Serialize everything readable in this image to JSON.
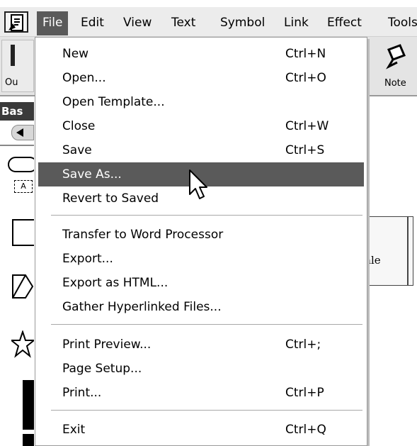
{
  "menubar": {
    "items": [
      "File",
      "Edit",
      "View",
      "Text",
      "Symbol",
      "Link",
      "Effect",
      "Tools"
    ],
    "active": "File"
  },
  "toolbar": {
    "left_label": "Ou",
    "note_label": "Note"
  },
  "palette": {
    "header": "Bas",
    "text_tool_label": "A"
  },
  "background": {
    "card_text": "ale"
  },
  "file_menu": {
    "items": [
      {
        "label": "New",
        "shortcut": "Ctrl+N"
      },
      {
        "label": "Open...",
        "shortcut": "Ctrl+O"
      },
      {
        "label": "Open Template...",
        "shortcut": ""
      },
      {
        "label": "Close",
        "shortcut": "Ctrl+W"
      },
      {
        "label": "Save",
        "shortcut": "Ctrl+S"
      },
      {
        "label": "Save As...",
        "shortcut": "",
        "highlighted": true
      },
      {
        "label": "Revert to Saved",
        "shortcut": ""
      },
      {
        "label": "Transfer to Word Processor",
        "shortcut": ""
      },
      {
        "label": "Export...",
        "shortcut": ""
      },
      {
        "label": "Export as HTML...",
        "shortcut": ""
      },
      {
        "label": "Gather Hyperlinked Files...",
        "shortcut": ""
      },
      {
        "label": "Print Preview...",
        "shortcut": "Ctrl+;"
      },
      {
        "label": "Page Setup...",
        "shortcut": ""
      },
      {
        "label": "Print...",
        "shortcut": "Ctrl+P"
      },
      {
        "label": "Exit",
        "shortcut": "Ctrl+Q"
      }
    ]
  },
  "colors": {
    "highlight": "#5a5a5a",
    "menubar_bg": "#ececec"
  },
  "icons": {
    "app": "app-document-icon",
    "note": "note-pen-icon",
    "cursor": "mouse-pointer-icon"
  }
}
